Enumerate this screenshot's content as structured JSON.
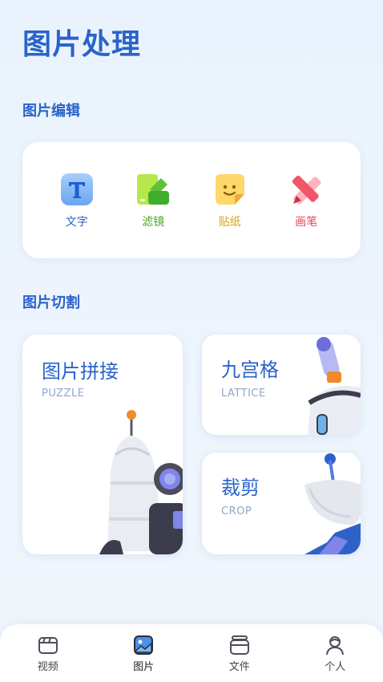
{
  "page": {
    "title": "图片处理"
  },
  "edit_section": {
    "title": "图片编辑",
    "tools": [
      {
        "label": "文字",
        "icon": "text-icon",
        "color": "#2a63c9"
      },
      {
        "label": "滤镜",
        "icon": "filter-icon",
        "color": "#4caa24"
      },
      {
        "label": "贴纸",
        "icon": "sticker-icon",
        "color": "#d8a320"
      },
      {
        "label": "画笔",
        "icon": "brush-icon",
        "color": "#e04a5a"
      }
    ]
  },
  "cut_section": {
    "title": "图片切割",
    "cards": [
      {
        "title": "图片拼接",
        "subtitle": "PUZZLE"
      },
      {
        "title": "九宫格",
        "subtitle": "LATTICE"
      },
      {
        "title": "裁剪",
        "subtitle": "CROP"
      }
    ]
  },
  "tabbar": {
    "tabs": [
      {
        "label": "视频",
        "icon": "video-icon"
      },
      {
        "label": "图片",
        "icon": "image-icon",
        "active": true
      },
      {
        "label": "文件",
        "icon": "folder-icon"
      },
      {
        "label": "个人",
        "icon": "person-icon"
      }
    ]
  }
}
